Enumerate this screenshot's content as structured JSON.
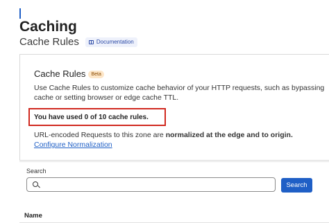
{
  "header": {
    "title": "Caching",
    "subtitle": "Cache Rules",
    "documentation_label": "Documentation"
  },
  "card": {
    "title": "Cache Rules",
    "badge": "Beta",
    "description": "Use Cache Rules to customize cache behavior of your HTTP requests, such as bypassing cache or setting browser or edge cache TTL.",
    "usage_text": "You have used 0 of 10 cache rules.",
    "normalization_prefix": "URL-encoded Requests to this zone are ",
    "normalization_bold": "normalized at the edge and to origin.",
    "configure_link": "Configure Normalization"
  },
  "search": {
    "label": "Search",
    "placeholder": "",
    "value": "",
    "button_label": "Search"
  },
  "table": {
    "columns": [
      "Name"
    ]
  },
  "colors": {
    "accent": "#1f5fc6",
    "highlight_border": "#d0281e",
    "beta_badge_bg": "#fde6c8"
  }
}
